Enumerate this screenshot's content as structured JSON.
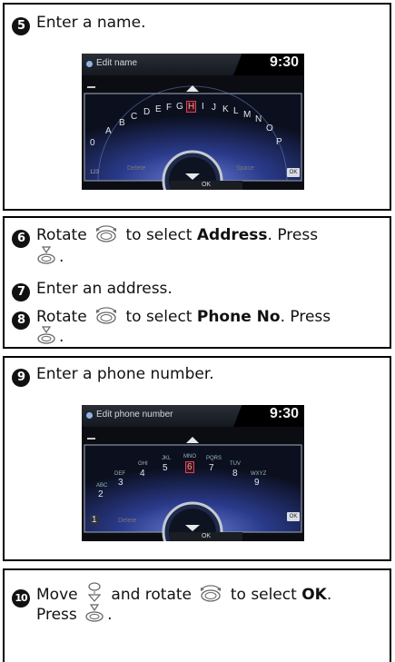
{
  "section1": {
    "step5": {
      "number": "5",
      "text": "Enter a name."
    },
    "screen": {
      "title": "Edit name",
      "time": "9:30",
      "letters": [
        "A",
        "B",
        "C",
        "D",
        "E",
        "F",
        "G",
        "H",
        "I",
        "J",
        "K",
        "L",
        "M",
        "N",
        "O",
        "P",
        "0"
      ],
      "selected_letter": "H",
      "left_button": "123",
      "ok_bottom": "OK",
      "ok_right": "OK",
      "faint_left": "Delete",
      "faint_right": "Space"
    }
  },
  "section2": {
    "step6": {
      "number": "6",
      "prefix": "Rotate",
      "mid": "to select",
      "bold": "Address",
      "suffix": ". Press",
      "end": "."
    },
    "step7": {
      "number": "7",
      "text": "Enter an address."
    },
    "step8": {
      "number": "8",
      "prefix": "Rotate",
      "mid": "to select",
      "bold": "Phone No",
      "suffix": ". Press",
      "end": "."
    }
  },
  "section3": {
    "step9": {
      "number": "9",
      "text": "Enter a phone number."
    },
    "screen": {
      "title": "Edit phone number",
      "time": "9:30",
      "keys": [
        "1",
        "2",
        "3",
        "4",
        "5",
        "6",
        "7",
        "8",
        "9"
      ],
      "key_letters": [
        "ABC",
        "DEF",
        "GHI",
        "JKL",
        "MNO",
        "PQRS",
        "TUV",
        "WXYZ"
      ],
      "selected_key": "6",
      "ok_bottom": "OK",
      "ok_right": "OK",
      "faint_left": "Delete"
    }
  },
  "section4": {
    "step10": {
      "number": "10",
      "prefix": "Move",
      "mid1": "and rotate",
      "mid2": "to select",
      "bold": "OK",
      "dot": ".",
      "line2": "Press",
      "end": "."
    }
  },
  "icons": [
    "dial-rotate-icon",
    "dial-press-icon",
    "dial-move-down-icon"
  ]
}
